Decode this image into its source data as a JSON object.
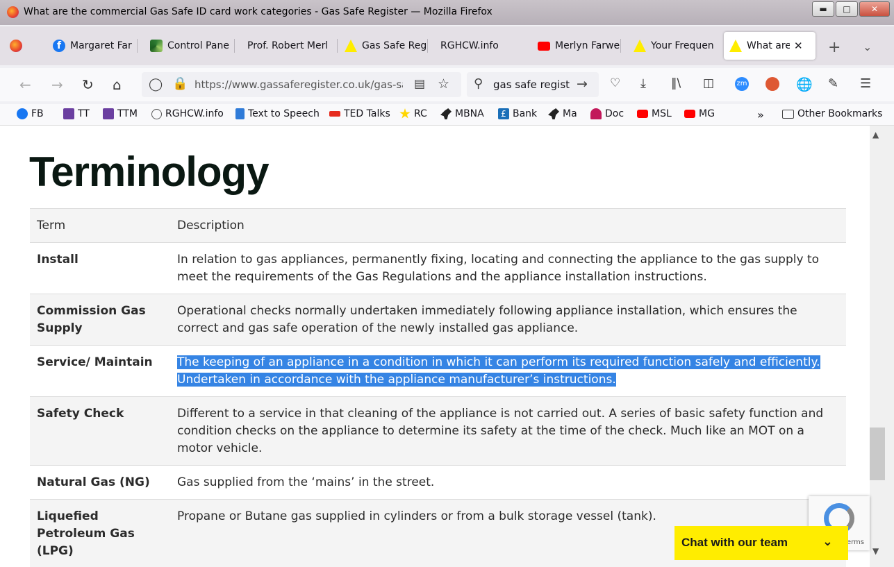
{
  "window": {
    "title": "What are the commercial Gas Safe ID card work categories - Gas Safe Register — Mozilla Firefox"
  },
  "tabs": [
    {
      "label": ""
    },
    {
      "label": "Margaret Far"
    },
    {
      "label": "Control Pane"
    },
    {
      "label": "Prof. Robert Merl"
    },
    {
      "label": "Gas Safe Reg"
    },
    {
      "label": "RGHCW.info"
    },
    {
      "label": "Merlyn Farwe"
    },
    {
      "label": "Your Frequen"
    },
    {
      "label": "What are t"
    }
  ],
  "nav": {
    "url": "https://www.gassaferegister.co.uk/gas-sa",
    "search_query": "gas safe regist"
  },
  "bookmarks": [
    {
      "label": "FB",
      "icon": "facebook-icon",
      "color": "#1877f2"
    },
    {
      "label": "TT",
      "icon": "t-icon",
      "color": "#6b3fa0"
    },
    {
      "label": "TTM",
      "icon": "t-icon",
      "color": "#6b3fa0"
    },
    {
      "label": "RGHCW.info",
      "icon": "globe-icon",
      "color": "#555555"
    },
    {
      "label": "Text to Speech",
      "icon": "n-icon",
      "color": "#2f7bd8"
    },
    {
      "label": "TED Talks",
      "icon": "ted-icon",
      "color": "#e62b1e"
    },
    {
      "label": "RC",
      "icon": "star-icon",
      "color": "#1d4fb3"
    },
    {
      "label": "MBNA",
      "icon": "horse-icon",
      "color": "#222222"
    },
    {
      "label": "Bank",
      "icon": "pound-icon",
      "color": "#1a6fb8"
    },
    {
      "label": "Ma",
      "icon": "horse-icon",
      "color": "#222222"
    },
    {
      "label": "Doc",
      "icon": "heart-icon",
      "color": "#c2185b"
    },
    {
      "label": "MSL",
      "icon": "youtube-icon",
      "color": "#ff0000"
    },
    {
      "label": "MG",
      "icon": "youtube-icon",
      "color": "#ff0000"
    }
  ],
  "other_bookmarks": "Other Bookmarks",
  "page": {
    "heading": "Terminology",
    "table": {
      "headers": [
        "Term",
        "Description"
      ],
      "rows": [
        {
          "term": "Install",
          "description": "In relation to gas appliances, permanently fixing, locating and connecting the appliance to the gas supply to meet the requirements of the Gas Regulations and the appliance installation instructions."
        },
        {
          "term": "Commission Gas Supply",
          "description": "Operational checks normally undertaken immediately following appliance installation, which ensures the correct and gas safe operation of the newly installed gas appliance."
        },
        {
          "term": "Service/ Maintain",
          "description": "The keeping of an appliance in a condition in which it can perform its required function safely and efficiently. Undertaken in accordance with the appliance manufacturer’s instructions."
        },
        {
          "term": "Safety Check",
          "description": "Different to a service in that cleaning of the appliance is not carried out. A series of basic safety function and condition checks on the appliance to determine its safety at the time of the check. Much like an MOT on a motor vehicle."
        },
        {
          "term": "Natural Gas (NG)",
          "description": "Gas supplied from the ‘mains’ in the street."
        },
        {
          "term": "Liquefied Petroleum Gas (LPG)",
          "description": "Propane or Butane gas supplied in cylinders or from a bulk storage vessel (tank)."
        }
      ]
    },
    "recaptcha_text": "Terms",
    "chat_label": "Chat with our team"
  },
  "colors": {
    "accent_highlight": "#3584e4",
    "chat_bg": "#ffed00"
  }
}
